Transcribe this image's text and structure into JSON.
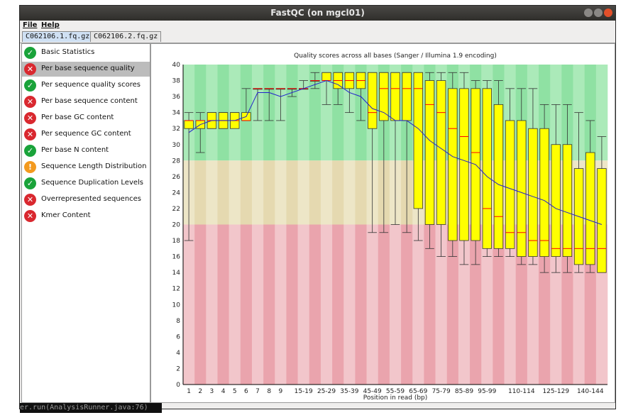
{
  "window": {
    "title": "FastQC (on mgcl01)"
  },
  "menu": {
    "file": "File",
    "help": "Help"
  },
  "tabs": [
    {
      "label": "C062106.1.fq.gz",
      "active": true
    },
    {
      "label": "C062106.2.fq.gz",
      "active": false
    }
  ],
  "modules": [
    {
      "label": "Basic Statistics",
      "status": "pass",
      "selected": false
    },
    {
      "label": "Per base sequence quality",
      "status": "fail",
      "selected": true
    },
    {
      "label": "Per sequence quality scores",
      "status": "pass",
      "selected": false
    },
    {
      "label": "Per base sequence content",
      "status": "fail",
      "selected": false
    },
    {
      "label": "Per base GC content",
      "status": "fail",
      "selected": false
    },
    {
      "label": "Per sequence GC content",
      "status": "fail",
      "selected": false
    },
    {
      "label": "Per base N content",
      "status": "pass",
      "selected": false
    },
    {
      "label": "Sequence Length Distribution",
      "status": "warn",
      "selected": false
    },
    {
      "label": "Sequence Duplication Levels",
      "status": "pass",
      "selected": false
    },
    {
      "label": "Overrepresented sequences",
      "status": "fail",
      "selected": false
    },
    {
      "label": "Kmer Content",
      "status": "fail",
      "selected": false
    }
  ],
  "console": {
    "text": "er.run(AnalysisRunner.java:76)"
  },
  "colors": {
    "good_bg": "#abeab9",
    "good_bg_alt": "#8fe1a3",
    "warn_bg": "#ede6c7",
    "warn_bg_alt": "#e5d9b0",
    "bad_bg": "#f2c6cb",
    "bad_bg_alt": "#eaa4ad",
    "box_fill": "#ffff00",
    "median": "#ff0000",
    "mean": "#2222cc"
  },
  "chart_data": {
    "type": "box",
    "title": "Quality scores across all bases (Sanger / Illumina 1.9 encoding)",
    "xlabel": "Position in read (bp)",
    "ylim": [
      0,
      40
    ],
    "yticks": [
      0,
      2,
      4,
      6,
      8,
      10,
      12,
      14,
      16,
      18,
      20,
      22,
      24,
      26,
      28,
      30,
      32,
      34,
      36,
      38,
      40
    ],
    "zones": [
      {
        "name": "good",
        "from": 28,
        "to": 40
      },
      {
        "name": "warn",
        "from": 20,
        "to": 28
      },
      {
        "name": "bad",
        "from": 0,
        "to": 20
      }
    ],
    "x_tick_labels": [
      "1",
      "2",
      "3",
      "4",
      "5",
      "6",
      "7",
      "8",
      "9",
      "15-19",
      "25-29",
      "35-39",
      "45-49",
      "55-59",
      "65-69",
      "75-79",
      "85-89",
      "95-99",
      "110-114",
      "125-129",
      "140-144"
    ],
    "categories": [
      "1",
      "2",
      "3",
      "4",
      "5",
      "6",
      "7",
      "8",
      "9",
      "10-14",
      "15-19",
      "20-24",
      "25-29",
      "30-34",
      "35-39",
      "40-44",
      "45-49",
      "50-54",
      "55-59",
      "60-64",
      "65-69",
      "70-74",
      "75-79",
      "80-84",
      "85-89",
      "90-94",
      "95-99",
      "100-104",
      "105-109",
      "110-114",
      "115-119",
      "120-124",
      "125-129",
      "130-134",
      "135-139",
      "140-144",
      "145-150"
    ],
    "label_indices": [
      0,
      1,
      2,
      3,
      4,
      5,
      6,
      7,
      8,
      10,
      12,
      14,
      16,
      18,
      20,
      22,
      24,
      26,
      29,
      32,
      35
    ],
    "series": [
      {
        "name": "lower_whisker",
        "values": [
          18,
          29,
          32,
          32,
          33,
          33,
          33,
          33,
          33,
          36,
          37,
          37,
          35,
          35,
          34,
          33,
          19,
          19,
          20,
          19,
          18,
          17,
          16,
          16,
          15,
          15,
          16,
          16,
          16,
          15,
          15,
          14,
          14,
          14,
          14,
          14,
          14
        ]
      },
      {
        "name": "q1",
        "values": [
          32,
          32,
          32,
          32,
          32,
          33,
          37,
          37,
          37,
          37,
          37,
          38,
          38,
          37,
          37,
          37,
          32,
          33,
          33,
          33,
          22,
          20,
          20,
          18,
          18,
          18,
          17,
          17,
          17,
          16,
          16,
          16,
          16,
          16,
          15,
          15,
          14
        ]
      },
      {
        "name": "median",
        "values": [
          33,
          33,
          33,
          33,
          33,
          33,
          37,
          37,
          37,
          37,
          37,
          38,
          38,
          38,
          38,
          38,
          34,
          37,
          37,
          37,
          37,
          35,
          34,
          32,
          31,
          29,
          22,
          21,
          19,
          19,
          18,
          18,
          17,
          17,
          17,
          17,
          17
        ]
      },
      {
        "name": "q3",
        "values": [
          33,
          33,
          34,
          34,
          34,
          34,
          37,
          37,
          37,
          37,
          37,
          38,
          39,
          39,
          39,
          39,
          39,
          39,
          39,
          39,
          39,
          38,
          38,
          37,
          37,
          37,
          37,
          35,
          33,
          33,
          32,
          32,
          30,
          30,
          27,
          29,
          27
        ]
      },
      {
        "name": "upper_whisker",
        "values": [
          34,
          34,
          34,
          34,
          34,
          37,
          37,
          37,
          37,
          37,
          38,
          39,
          39,
          39,
          39,
          39,
          39,
          39,
          39,
          39,
          39,
          39,
          39,
          39,
          39,
          38,
          38,
          38,
          37,
          37,
          37,
          35,
          35,
          35,
          34,
          33,
          31
        ]
      },
      {
        "name": "mean",
        "values": [
          31.5,
          32.5,
          33,
          33,
          33,
          33.5,
          36.5,
          36.5,
          36,
          36.5,
          37,
          37.5,
          38,
          37.5,
          36.5,
          36,
          34.5,
          34,
          33,
          33,
          32,
          30.5,
          29.5,
          28.5,
          28,
          27.5,
          26,
          25,
          24.5,
          24,
          23.5,
          23,
          22,
          21.5,
          21,
          20.5,
          20
        ]
      }
    ]
  }
}
